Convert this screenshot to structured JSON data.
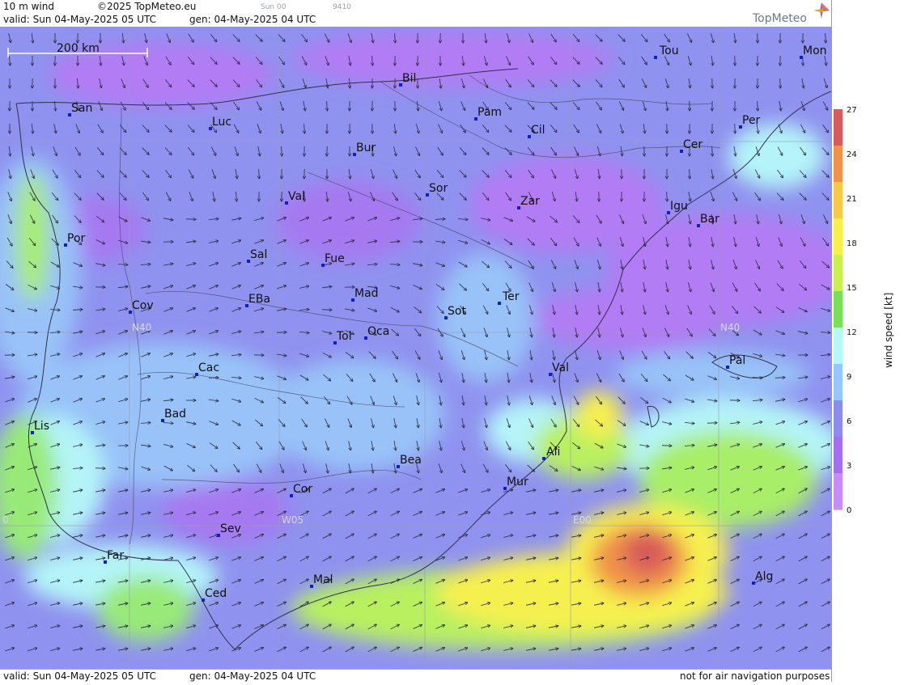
{
  "header": {
    "product": "10 m wind",
    "copyright": "©2025 TopMeteo.eu",
    "valid": "valid:  Sun  04-May-2025  05 UTC",
    "gen": "gen: 04-May-2025 04 UTC",
    "small_run": "Sun 00",
    "small_code": "9410",
    "logo": "TopMeteo"
  },
  "footer": {
    "valid": "valid:  Sun  04-May-2025  05 UTC",
    "gen": "gen: 04-May-2025 04 UTC",
    "disclaimer": "not for air navigation purposes"
  },
  "scale_bar": {
    "label": "200 km"
  },
  "grid_labels": [
    {
      "text": "N40"
    },
    {
      "text": "N40"
    },
    {
      "text": "W05"
    },
    {
      "text": "E00"
    },
    {
      "text": "0"
    }
  ],
  "colorbar": {
    "title": "wind speed  [kt]",
    "ticks": [
      "27",
      "24",
      "21",
      "18",
      "15",
      "12",
      "9",
      "6",
      "3",
      "0"
    ],
    "colors": [
      "#d85a5a",
      "#f0924a",
      "#f8c848",
      "#f8f048",
      "#c8f050",
      "#78e058",
      "#b4f8f8",
      "#96c8ff",
      "#8c8cf0",
      "#a46ef0",
      "#c88cf8"
    ]
  },
  "cities": [
    {
      "name": "Tou"
    },
    {
      "name": "Mon"
    },
    {
      "name": "Bil"
    },
    {
      "name": "San"
    },
    {
      "name": "Pam"
    },
    {
      "name": "Luc"
    },
    {
      "name": "Cil"
    },
    {
      "name": "Per"
    },
    {
      "name": "Cer"
    },
    {
      "name": "Bur"
    },
    {
      "name": "Sor"
    },
    {
      "name": "Val"
    },
    {
      "name": "Zar"
    },
    {
      "name": "Igu"
    },
    {
      "name": "Bar"
    },
    {
      "name": "Por"
    },
    {
      "name": "Sal"
    },
    {
      "name": "Fue"
    },
    {
      "name": "Mad"
    },
    {
      "name": "Ter"
    },
    {
      "name": "Cov"
    },
    {
      "name": "EBa"
    },
    {
      "name": "Sot"
    },
    {
      "name": "Oca"
    },
    {
      "name": "Tol"
    },
    {
      "name": "Pal"
    },
    {
      "name": "Cac"
    },
    {
      "name": "Val"
    },
    {
      "name": "Bad"
    },
    {
      "name": "Lis"
    },
    {
      "name": "Ali"
    },
    {
      "name": "Bea"
    },
    {
      "name": "Mur"
    },
    {
      "name": "Cor"
    },
    {
      "name": "Sev"
    },
    {
      "name": "Far"
    },
    {
      "name": "Alg"
    },
    {
      "name": "Mal"
    },
    {
      "name": "Ced"
    }
  ]
}
